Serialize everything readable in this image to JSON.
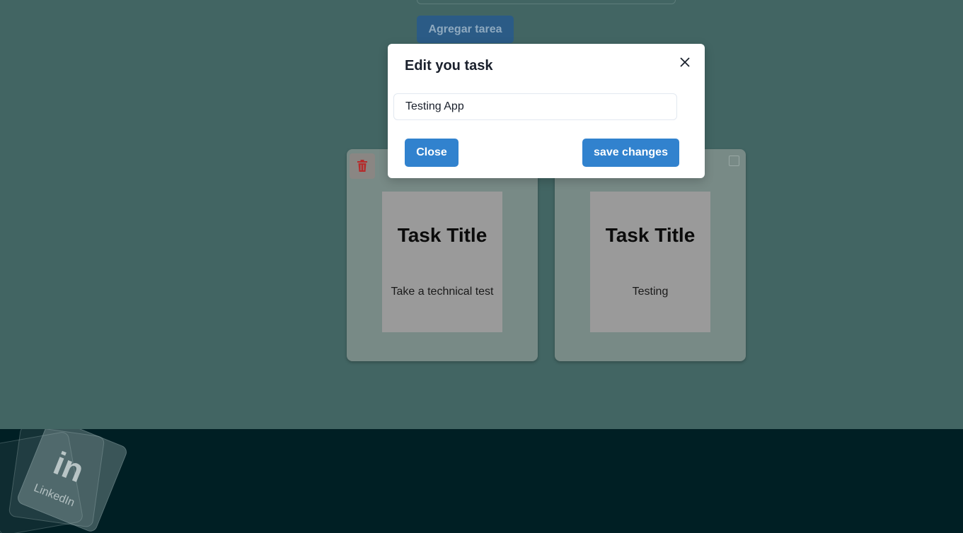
{
  "top_form": {
    "add_button_label": "Agregar tarea"
  },
  "modal": {
    "title": "Edit you task",
    "input_value": "Testing App",
    "close_label": "Close",
    "save_label": "save changes"
  },
  "tasks": [
    {
      "title": "Task Title",
      "description": "Take a technical test"
    },
    {
      "title": "Task Title",
      "description": "Testing"
    }
  ],
  "footer": {
    "social_logo_text": "in",
    "social_label": "LinkedIn"
  },
  "colors": {
    "background": "#426563",
    "footer": "#001f24",
    "primary_button": "#3182ce",
    "delete_icon": "#c53030"
  }
}
